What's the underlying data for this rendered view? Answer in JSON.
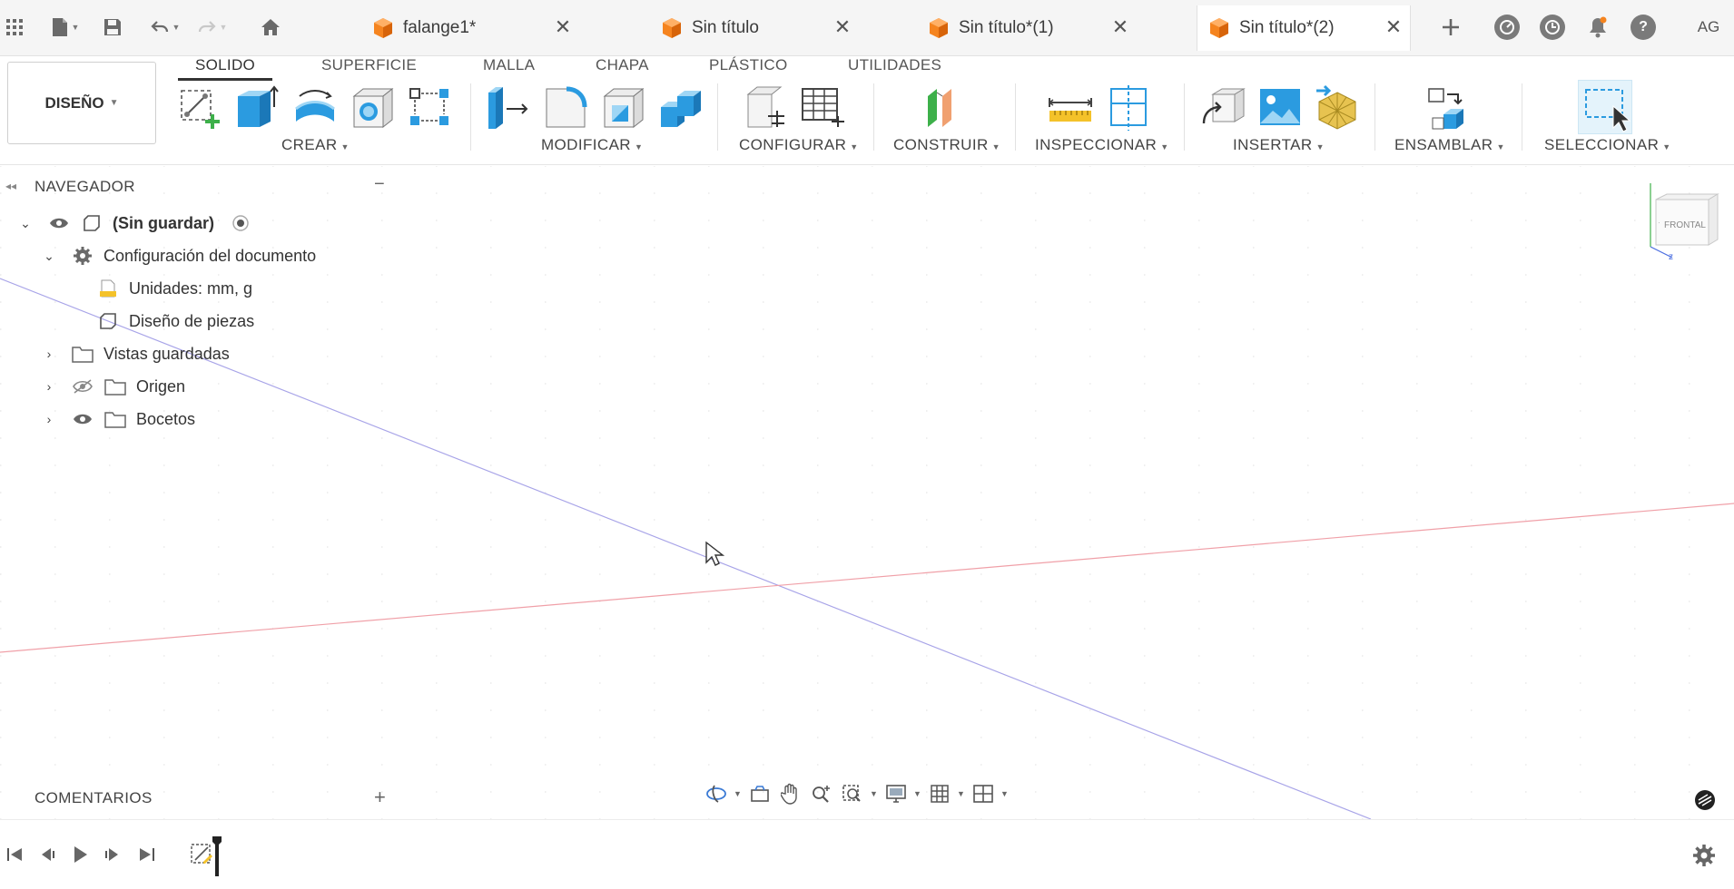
{
  "tabs": [
    {
      "label": "falange1*",
      "active": false
    },
    {
      "label": "Sin título",
      "active": false
    },
    {
      "label": "Sin título*(1)",
      "active": false
    },
    {
      "label": "Sin título*(2)",
      "active": true
    }
  ],
  "user": {
    "initials": "AG"
  },
  "toolbar": {
    "workspace": "DISEÑO",
    "workspace_tabs": [
      "SOLIDO",
      "SUPERFICIE",
      "MALLA",
      "CHAPA",
      "PLÁSTICO",
      "UTILIDADES"
    ],
    "active_tab": "SOLIDO",
    "groups": [
      "CREAR",
      "MODIFICAR",
      "CONFIGURAR",
      "CONSTRUIR",
      "INSPECCIONAR",
      "INSERTAR",
      "ENSAMBLAR",
      "SELECCIONAR"
    ]
  },
  "navigator": {
    "title": "NAVEGADOR",
    "root": "(Sin guardar)",
    "doc_settings": "Configuración del documento",
    "units": "Unidades: mm, g",
    "design": "Diseño de piezas",
    "saved_views": "Vistas guardadas",
    "origin": "Origen",
    "sketches": "Bocetos"
  },
  "viewcube": {
    "face": "FRONTAL"
  },
  "comments": {
    "title": "COMENTARIOS"
  },
  "colors": {
    "x_axis": "#f0a0a8",
    "z_axis": "#a8a4e8",
    "accent": "#0696d7",
    "tab_cube": "#f5841f"
  }
}
